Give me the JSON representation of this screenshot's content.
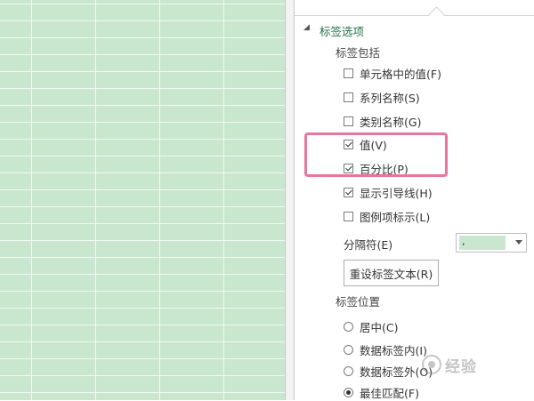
{
  "label_options": {
    "section_title": "标签选项",
    "includes_title": "标签包括",
    "checkboxes": [
      {
        "label": "单元格中的值(F)",
        "checked": false
      },
      {
        "label": "系列名称(S)",
        "checked": false
      },
      {
        "label": "类别名称(G)",
        "checked": false
      },
      {
        "label": "值(V)",
        "checked": true
      },
      {
        "label": "百分比(P)",
        "checked": true
      },
      {
        "label": "显示引导线(H)",
        "checked": true
      },
      {
        "label": "图例项标示(L)",
        "checked": false
      }
    ],
    "separator": {
      "label": "分隔符(E)",
      "value": ","
    },
    "reset_button": "重设标签文本(R)",
    "position_title": "标签位置",
    "positions": [
      {
        "label": "居中(C)",
        "selected": false
      },
      {
        "label": "数据标签内(I)",
        "selected": false
      },
      {
        "label": "数据标签外(O)",
        "selected": false
      },
      {
        "label": "最佳匹配(F)",
        "selected": true
      }
    ]
  },
  "watermark": "经验",
  "colors": {
    "sheet": "#c9e6cf",
    "highlight": "#e8769f",
    "section_title": "#217346"
  }
}
